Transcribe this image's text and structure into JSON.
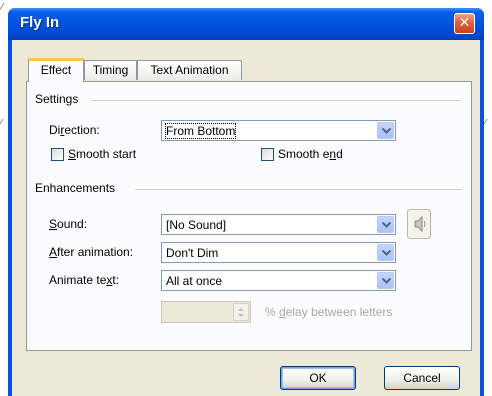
{
  "dialog": {
    "title": "Fly In",
    "close_glyph": "✕"
  },
  "tabs": [
    {
      "label": "Effect",
      "active": true
    },
    {
      "label": "Timing",
      "active": false
    },
    {
      "label": "Text Animation",
      "active": false
    }
  ],
  "settings": {
    "group_label": "Settings",
    "direction_label_pre": "Di",
    "direction_label_key": "r",
    "direction_label_post": "ection:",
    "direction_value": "From Bottom",
    "smooth_start_pre": "",
    "smooth_start_key": "S",
    "smooth_start_post": "mooth start",
    "smooth_start_checked": false,
    "smooth_end_pre": "Smooth e",
    "smooth_end_key": "n",
    "smooth_end_post": "d",
    "smooth_end_checked": false
  },
  "enhancements": {
    "group_label": "Enhancements",
    "sound_label_key": "S",
    "sound_label_post": "ound:",
    "sound_value": "[No Sound]",
    "after_label_key": "A",
    "after_label_post": "fter animation:",
    "after_value": "Don't Dim",
    "animate_label_pre": "Animate te",
    "animate_label_key": "x",
    "animate_label_post": "t:",
    "animate_value": "All at once",
    "delay_value": "",
    "delay_pre": "% ",
    "delay_key": "d",
    "delay_post": "elay between letters"
  },
  "buttons": {
    "ok": "OK",
    "cancel": "Cancel"
  },
  "colors": {
    "title_blue": "#0054e3",
    "face": "#ece9d8",
    "tab_highlight": "#ffc83c",
    "close_red": "#e0603c"
  }
}
